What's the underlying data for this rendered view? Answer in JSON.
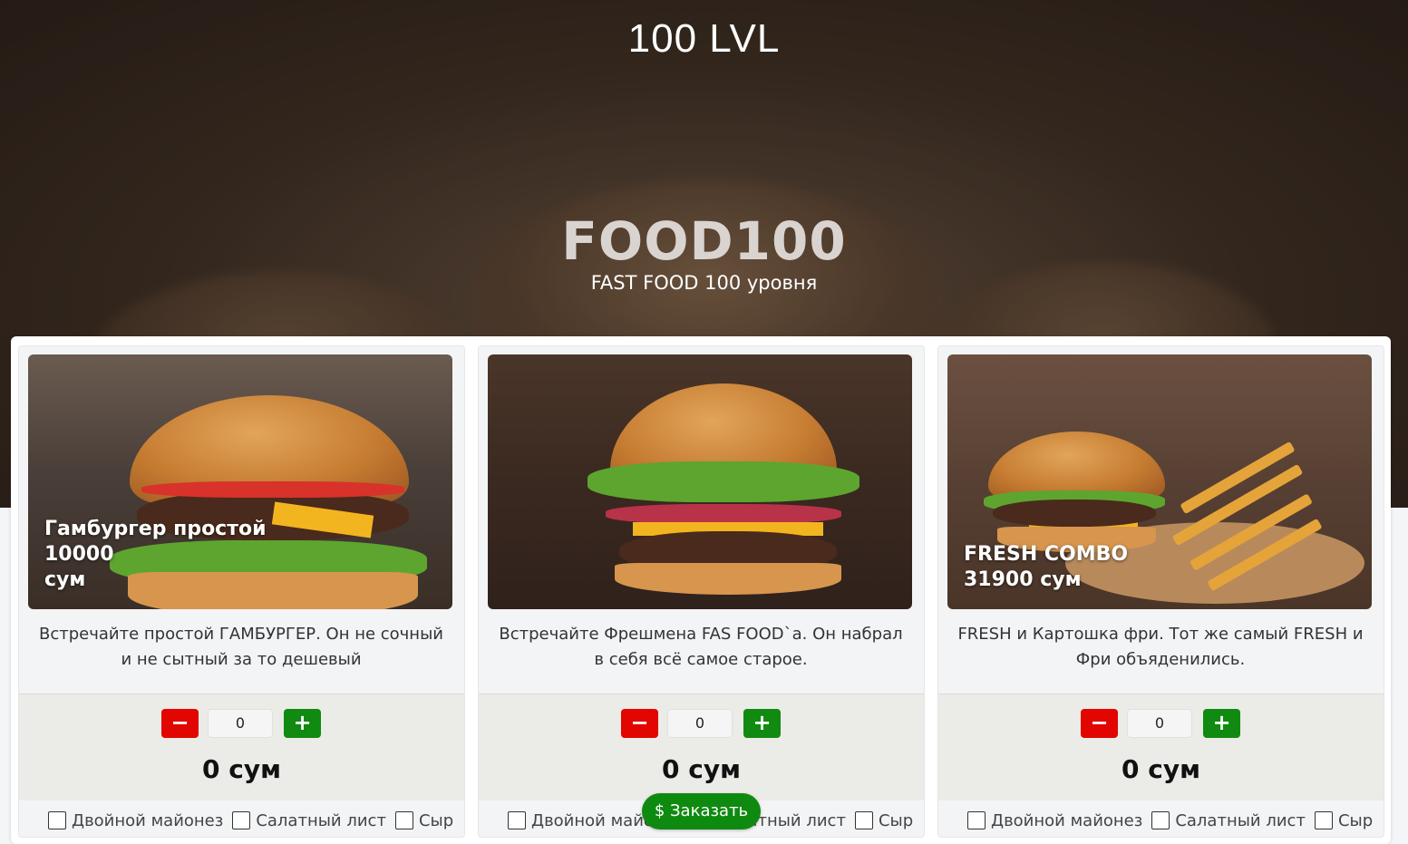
{
  "header": {
    "site_title": "100 LVL",
    "brand": "FOOD100",
    "tagline": "FAST FOOD 100 уровня"
  },
  "products": [
    {
      "caption": "Гамбургер простой\n10000\nсум",
      "description": "Встречайте простой ГАМБУРГЕР. Он не сочный и не сытный за то дешевый",
      "minus_label": "−",
      "plus_label": "+",
      "quantity": "0",
      "total": "0 сум",
      "options": [
        "Двойной майонез",
        "Салатный лист",
        "Сыр"
      ]
    },
    {
      "caption": "",
      "description": "Встречайте Фрешмена FAS FOOD`a. Он набрал в себя всё самое старое.",
      "minus_label": "−",
      "plus_label": "+",
      "quantity": "0",
      "total": "0 сум",
      "options": [
        "Двойной майонез",
        "Салатный лист",
        "Сыр"
      ]
    },
    {
      "caption": "FRESH COMBO\n31900 сум",
      "description": "FRESH и Картошка фри. Тот же самый FRESH и Фри объяденились.",
      "minus_label": "−",
      "plus_label": "+",
      "quantity": "0",
      "total": "0 сум",
      "options": [
        "Двойной майонез",
        "Салатный лист",
        "Сыр"
      ]
    }
  ],
  "order_button": {
    "icon": "$",
    "label": "Заказать"
  },
  "colors": {
    "minus": "#e10600",
    "plus": "#108a10",
    "order": "#0f8a10"
  }
}
